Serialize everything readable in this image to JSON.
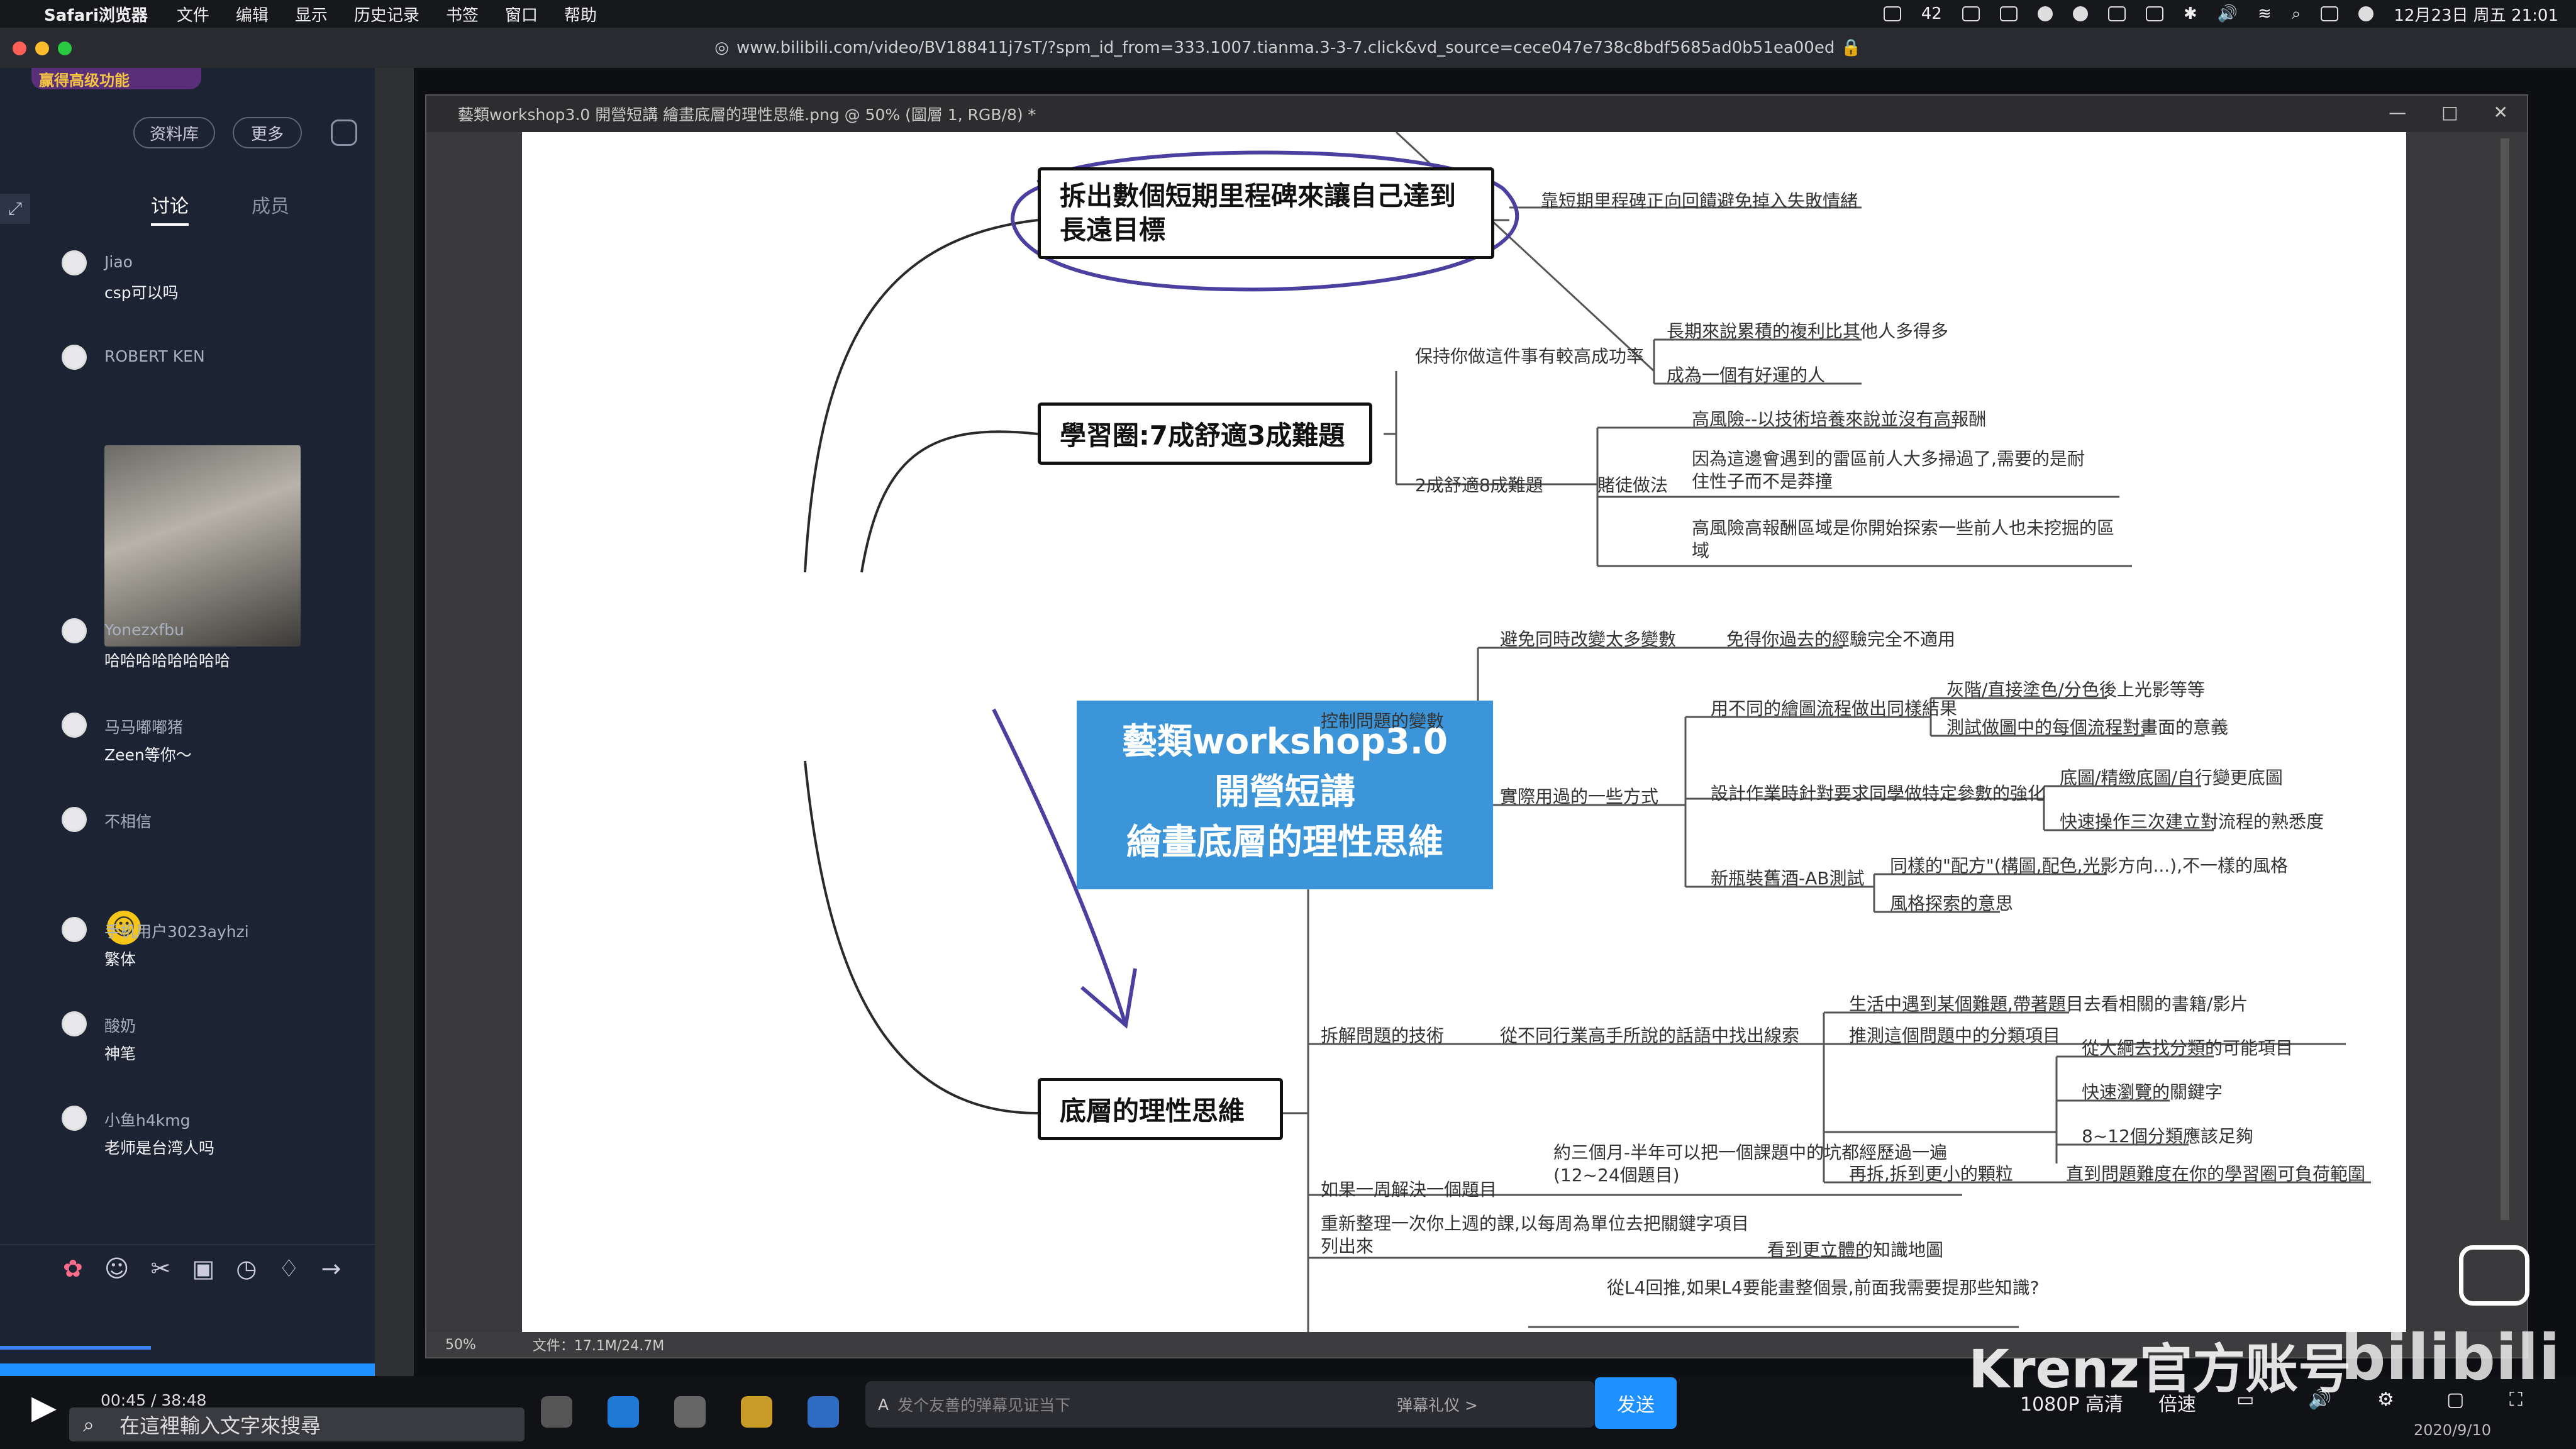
{
  "menubar": {
    "apple": "",
    "app": "Safari浏览器",
    "items": [
      "文件",
      "编辑",
      "显示",
      "历史记录",
      "书签",
      "窗口",
      "帮助"
    ],
    "badge": "42",
    "datetime": "12月23日 周五 21:01"
  },
  "address": "www.bilibili.com/video/BV188411j7sT/?spm_id_from=333.1007.tianma.3-3-7.click&vd_source=cece047e738c8bdf5685ad0b51ea00ed",
  "sidebar": {
    "logo": "赢得高级功能",
    "btn_library": "资料库",
    "btn_more": "更多",
    "tab_discuss": "讨论",
    "tab_members": "成员",
    "messages": [
      {
        "name": "Jiao",
        "text": "csp可以吗"
      },
      {
        "name": "ROBERT KEN",
        "text": ""
      },
      {
        "name": "Yonezxfbu",
        "text": "哈哈哈哈哈哈哈哈"
      },
      {
        "name": "马马嘟嘟猪",
        "text": "Zeen等你～"
      },
      {
        "name": "不相信",
        "text": ""
      },
      {
        "name": "手机用户3023ayhzi",
        "text": "繁体"
      },
      {
        "name": "酸奶",
        "text": "神笔"
      },
      {
        "name": "小鱼h4kmg",
        "text": "老师是台湾人吗"
      }
    ]
  },
  "photoshop": {
    "title": "藝類workshop3.0 開營短講 繪畫底層的理性思維.png @ 50% (圖層 1, RGB/8) *",
    "zoom": "50%",
    "file": "文件：17.1M/24.7M"
  },
  "mindmap": {
    "center": [
      "藝類workshop3.0",
      "開營短講",
      "繪畫底層的理性思維"
    ],
    "b1": "拆出數個短期里程碑來讓自己達到長遠目標",
    "b1_note": "靠短期里程碑正向回饋避免掉入失敗情緒",
    "b2": "學習圈:7成舒適3成難題",
    "b2_keep": "保持你做這件事有較高成功率",
    "b2_k1": "長期來說累積的複利比其他人多得多",
    "b2_k2": "成為一個有好運的人",
    "b2_ratio": "2成舒適8成難題",
    "b2_gamble": "賭徒做法",
    "b2_g1": "高風險--以技術培養來說並沒有高報酬",
    "b2_g2": "因為這邊會遇到的雷區前人大多掃過了,需要的是耐住性子而不是莽撞",
    "b2_g3": "高風險高報酬區域是你開始探索一些前人也未挖掘的區域",
    "b3": "底層的理性思維",
    "ctrl": "控制問題的變數",
    "ctrl_avoid": "避免同時改變太多變數",
    "ctrl_avoid_n": "免得你過去的經驗完全不適用",
    "ctrl_practice": "實際用過的一些方式",
    "p1": "用不同的繪圖流程做出同樣結果",
    "p1a": "灰階/直接塗色/分色後上光影等等",
    "p1b": "測試做圖中的每個流程對畫面的意義",
    "p2": "設計作業時針對要求同學做特定參數的強化",
    "p2a": "底圖/精緻底圖/自行變更底圖",
    "p2b": "快速操作三次建立對流程的熟悉度",
    "p3": "新瓶裝舊酒-AB測試",
    "p3a": "同樣的\"配方\"(構圖,配色,光影方向...),不一樣的風格",
    "p3b": "風格探索的意思",
    "split": "拆解問題的技術",
    "split_from": "從不同行業高手所說的話語中找出線索",
    "split_life": "生活中遇到某個難題,帶著題目去看相關的書籍/影片",
    "split_guess": "推測這個問題中的分類項目",
    "s1": "從大綱去找分類的可能項目",
    "s2": "快速瀏覽的關鍵字",
    "s3": "8~12個分類應該足夠",
    "split_again": "再拆,拆到更小的顆粒",
    "split_again_n": "直到問題難度在你的學習圈可負荷範圍",
    "week": "如果一周解決一個題目",
    "week_n": "約三個月-半年可以把一個課題中的坑都經歷過一遍(12~24個題目)",
    "reorg": "重新整理一次你上週的課,以每周為單位去把關鍵字項目列出來",
    "reorg_n": "看到更立體的知識地圖",
    "l4": "從L4回推,如果L4要能畫整個景,前面我需要提那些知識?"
  },
  "player": {
    "time": "00:45 / 38:48",
    "search_placeholder": "在這裡輸入文字來搜尋",
    "danmu_placeholder": "发个友善的弹幕见证当下",
    "gift": "弹幕礼仪 >",
    "send": "发送",
    "quality": "1080P 高清",
    "speed": "倍速",
    "watermark": "Krenz官方账号",
    "date": "2020/9/10"
  }
}
